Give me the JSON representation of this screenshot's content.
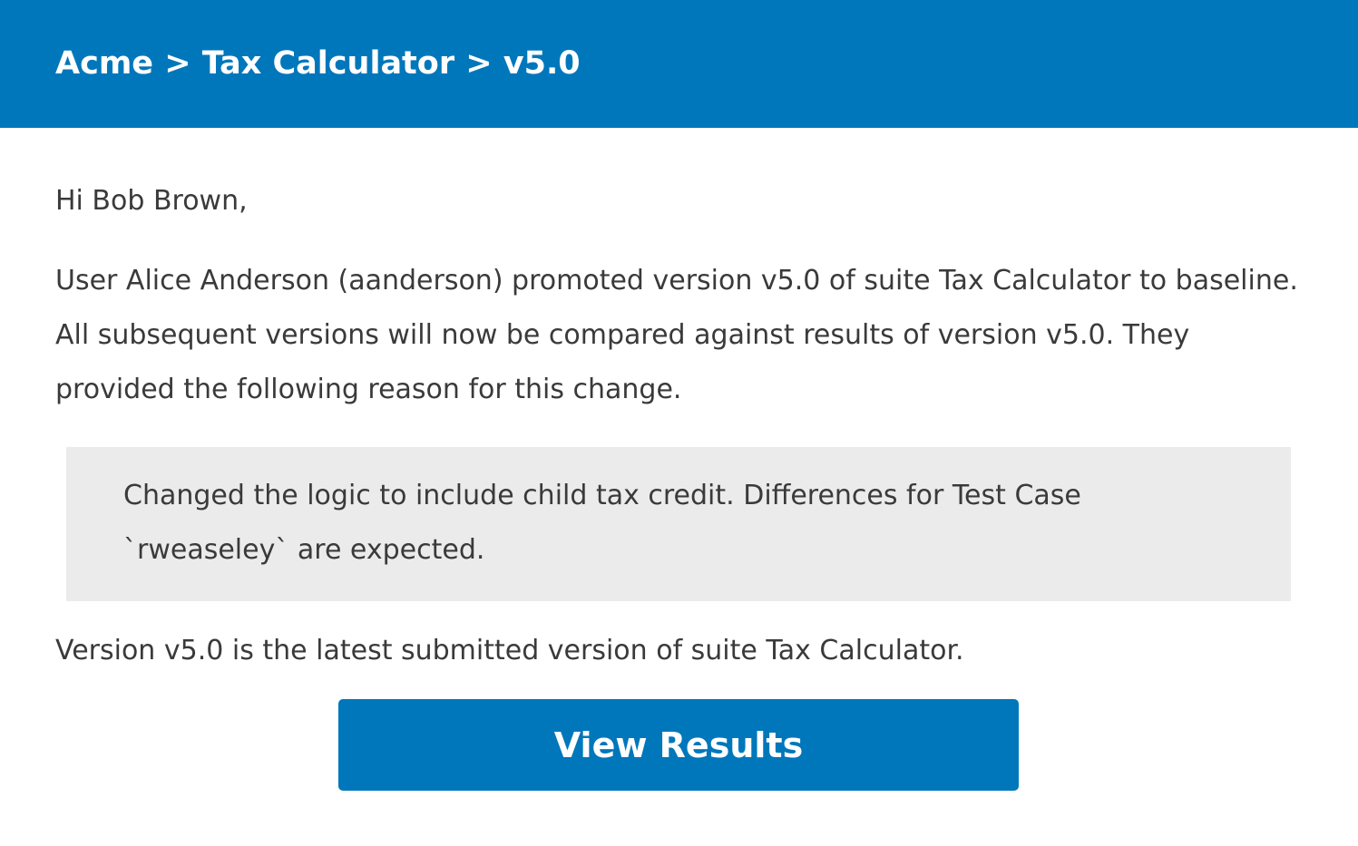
{
  "header": {
    "breadcrumb": "Acme > Tax Calculator > v5.0"
  },
  "email": {
    "greeting": "Hi Bob Brown,",
    "message": "User Alice Anderson (aanderson) promoted version v5.0 of suite Tax Calculator to baseline. All subsequent versions will now be compared against results of version v5.0. They provided the following reason for this change.",
    "reason": "Changed the logic to include child tax credit. Differences for Test Case `rweaseley` are expected.",
    "latest_note": "Version v5.0 is the latest submitted version of suite Tax Calculator.",
    "button_label": "View Results"
  },
  "colors": {
    "brand": "#0077bb",
    "reason_background": "#ebebeb",
    "text": "#3a3a3a"
  }
}
